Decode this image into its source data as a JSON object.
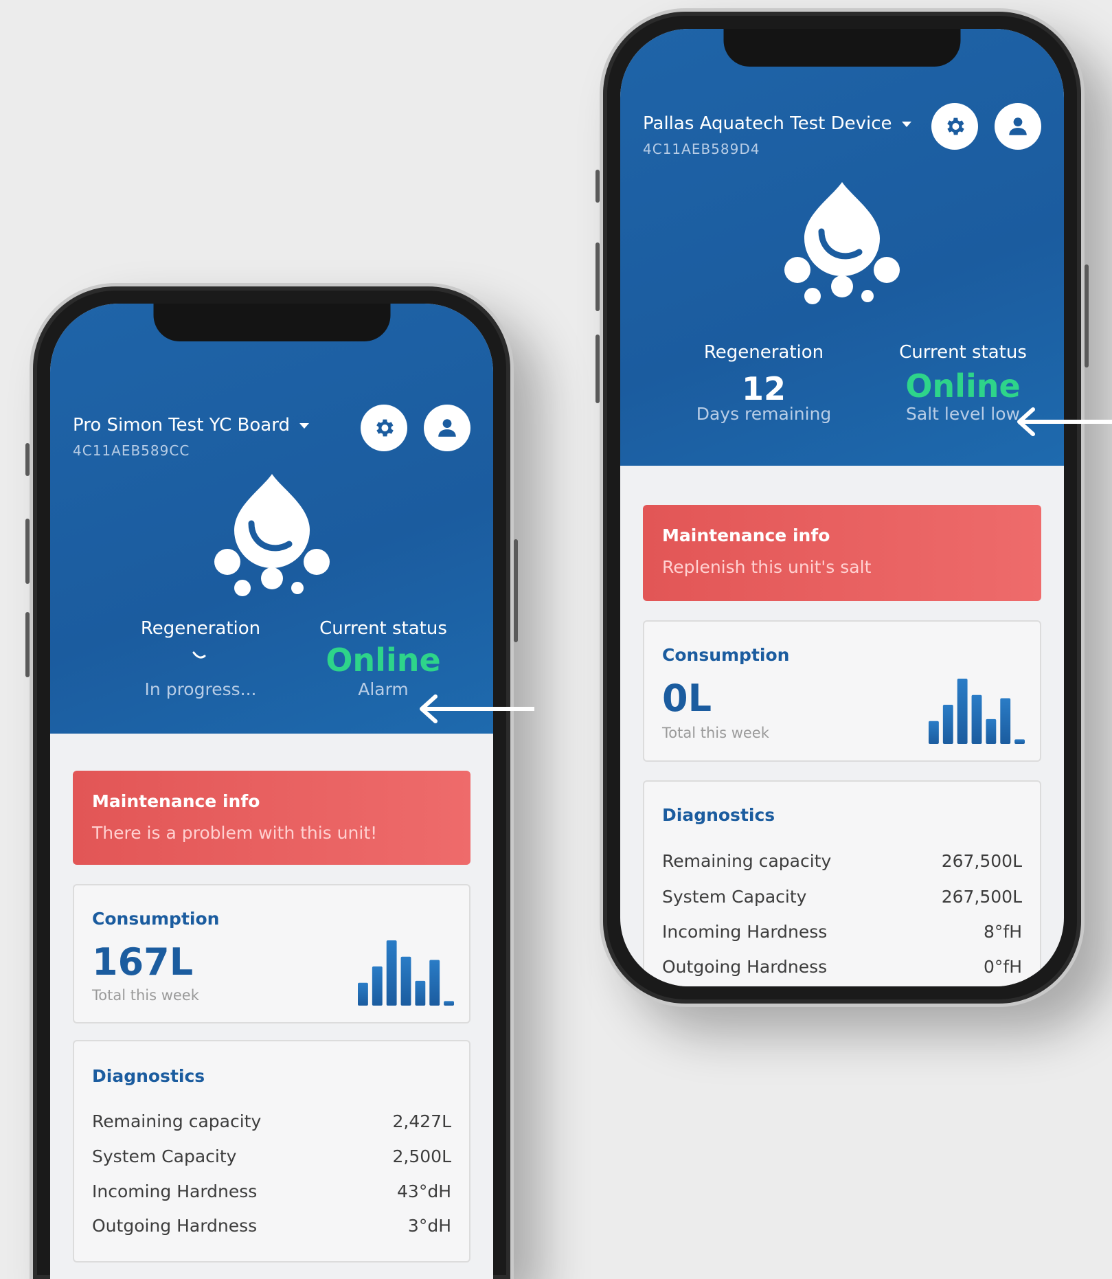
{
  "left": {
    "device": {
      "name": "Pro Simon Test YC Board",
      "id": "4C11AEB589CC"
    },
    "regeneration": {
      "label": "Regeneration",
      "value": "",
      "sub": "In progress..."
    },
    "status": {
      "label": "Current status",
      "value": "Online",
      "sub": "Alarm"
    },
    "maintenance": {
      "title": "Maintenance info",
      "message": "There is a problem with this unit!"
    },
    "consumption": {
      "title": "Consumption",
      "value": "167L",
      "sub": "Total this week",
      "bar_levels": [
        0.35,
        0.6,
        1.0,
        0.75,
        0.38,
        0.7,
        0.07
      ]
    },
    "diagnostics": {
      "title": "Diagnostics",
      "rows": [
        {
          "label": "Remaining capacity",
          "value": "2,427L"
        },
        {
          "label": "System Capacity",
          "value": "2,500L"
        },
        {
          "label": "Incoming Hardness",
          "value": "43°dH"
        },
        {
          "label": "Outgoing Hardness",
          "value": "3°dH"
        }
      ]
    }
  },
  "right": {
    "device": {
      "name": "Pallas Aquatech Test Device",
      "id": "4C11AEB589D4"
    },
    "regeneration": {
      "label": "Regeneration",
      "value": "12",
      "sub": "Days remaining"
    },
    "status": {
      "label": "Current status",
      "value": "Online",
      "sub": "Salt level low"
    },
    "maintenance": {
      "title": "Maintenance info",
      "message": "Replenish this unit's salt"
    },
    "consumption": {
      "title": "Consumption",
      "value": "0L",
      "sub": "Total this week",
      "bar_levels": [
        0.35,
        0.6,
        1.0,
        0.75,
        0.38,
        0.7,
        0.07
      ]
    },
    "diagnostics": {
      "title": "Diagnostics",
      "rows": [
        {
          "label": "Remaining capacity",
          "value": "267,500L"
        },
        {
          "label": "System Capacity",
          "value": "267,500L"
        },
        {
          "label": "Incoming Hardness",
          "value": "8°fH"
        },
        {
          "label": "Outgoing Hardness",
          "value": "0°fH"
        }
      ]
    }
  },
  "icons": {
    "settings": "gear-icon",
    "account": "user-icon",
    "logo": "water-drop-logo-icon",
    "arrow": "arrow-left-icon"
  },
  "colors": {
    "primary": "#1b5c9f",
    "online": "#2ed48a",
    "alert": "#e25656",
    "background": "#ececec"
  }
}
